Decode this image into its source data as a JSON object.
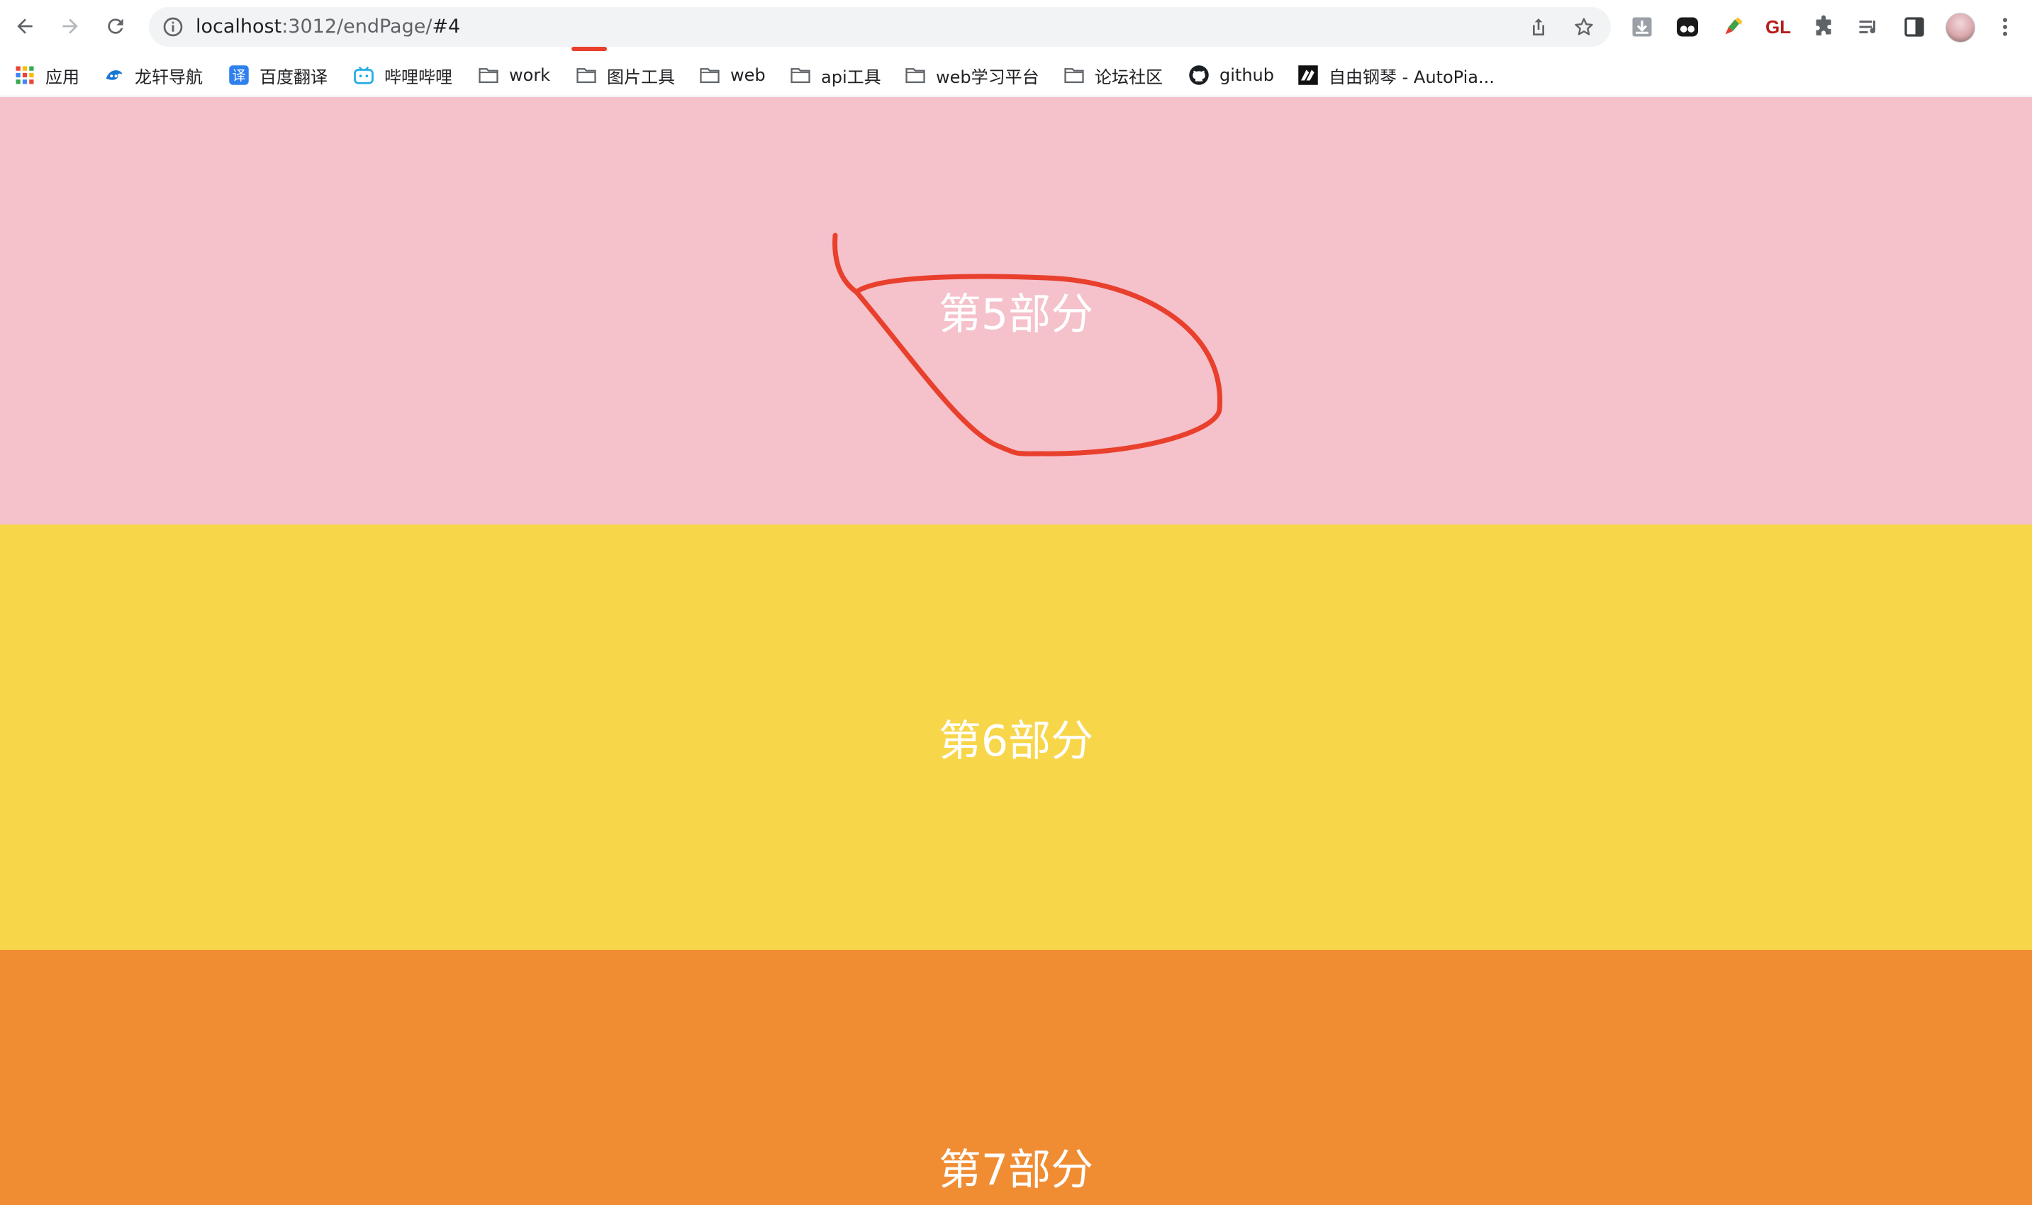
{
  "browser": {
    "url": {
      "host": "localhost",
      "path": ":3012/endPage/",
      "hash": "#4"
    },
    "extensions": [
      "download-icon",
      "tampermonkey-icon",
      "color-picker-icon",
      "GL",
      "puzzle-icon",
      "reading-list-icon",
      "side-panel-icon"
    ],
    "annotation_color": "#e8402d"
  },
  "bookmarks": [
    {
      "label": "应用",
      "icon": "apps-grid-icon"
    },
    {
      "label": "龙轩导航",
      "icon": "blue-bird-icon"
    },
    {
      "label": "百度翻译",
      "icon": "translate-icon"
    },
    {
      "label": "哔哩哔哩",
      "icon": "bilibili-icon"
    },
    {
      "label": "work",
      "icon": "folder-icon"
    },
    {
      "label": "图片工具",
      "icon": "folder-icon"
    },
    {
      "label": "web",
      "icon": "folder-icon"
    },
    {
      "label": "api工具",
      "icon": "folder-icon"
    },
    {
      "label": "web学习平台",
      "icon": "folder-icon"
    },
    {
      "label": "论坛社区",
      "icon": "folder-icon"
    },
    {
      "label": "github",
      "icon": "github-icon"
    },
    {
      "label": "自由钢琴 - AutoPia...",
      "icon": "piano-icon"
    }
  ],
  "sections": [
    {
      "title": "第5部分",
      "color": "#f5c1cb"
    },
    {
      "title": "第6部分",
      "color": "#f8d64a"
    },
    {
      "title": "第7部分",
      "color": "#f08d33"
    }
  ]
}
